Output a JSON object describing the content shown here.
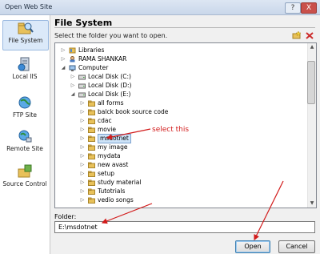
{
  "window": {
    "title": "Open Web Site",
    "help_label": "?",
    "close_label": "X"
  },
  "sidebar": {
    "items": [
      {
        "label": "File System",
        "icon": "folder-magnifier-icon"
      },
      {
        "label": "Local IIS",
        "icon": "server-icon"
      },
      {
        "label": "FTP Site",
        "icon": "globe-icon"
      },
      {
        "label": "Remote Site",
        "icon": "globe-network-icon"
      },
      {
        "label": "Source Control",
        "icon": "source-control-icon"
      }
    ]
  },
  "main": {
    "title": "File System",
    "instruction": "Select the folder you want to open."
  },
  "tree": {
    "nodes": [
      {
        "label": "Libraries",
        "icon": "library-icon",
        "expanded": false
      },
      {
        "label": "RAMA SHANKAR",
        "icon": "user-icon",
        "expanded": false
      },
      {
        "label": "Computer",
        "icon": "computer-icon",
        "expanded": true
      },
      {
        "label": "Local Disk (C:)",
        "icon": "drive-icon",
        "expanded": false
      },
      {
        "label": "Local Disk (D:)",
        "icon": "drive-icon",
        "expanded": false
      },
      {
        "label": "Local Disk (E:)",
        "icon": "drive-icon",
        "expanded": true
      },
      {
        "label": "all forms",
        "icon": "folder-icon",
        "expanded": false
      },
      {
        "label": "balck book source code",
        "icon": "folder-icon",
        "expanded": false
      },
      {
        "label": "cdac",
        "icon": "folder-icon",
        "expanded": false
      },
      {
        "label": "movie",
        "icon": "folder-icon",
        "expanded": false
      },
      {
        "label": "msdotnet",
        "icon": "folder-icon",
        "expanded": false,
        "selected": true
      },
      {
        "label": "my image",
        "icon": "folder-icon",
        "expanded": false
      },
      {
        "label": "mydata",
        "icon": "folder-icon",
        "expanded": false
      },
      {
        "label": "new avast",
        "icon": "folder-icon",
        "expanded": false
      },
      {
        "label": "setup",
        "icon": "folder-icon",
        "expanded": false
      },
      {
        "label": "study material",
        "icon": "folder-icon",
        "expanded": false
      },
      {
        "label": "Tutotrials",
        "icon": "folder-icon",
        "expanded": false
      },
      {
        "label": "vedio songs",
        "icon": "folder-icon",
        "expanded": false
      }
    ]
  },
  "folder": {
    "label": "Folder:",
    "value": "E:\\msdotnet"
  },
  "buttons": {
    "open": "Open",
    "cancel": "Cancel"
  },
  "annotation": {
    "text": "select this",
    "color": "#d21b1b"
  }
}
